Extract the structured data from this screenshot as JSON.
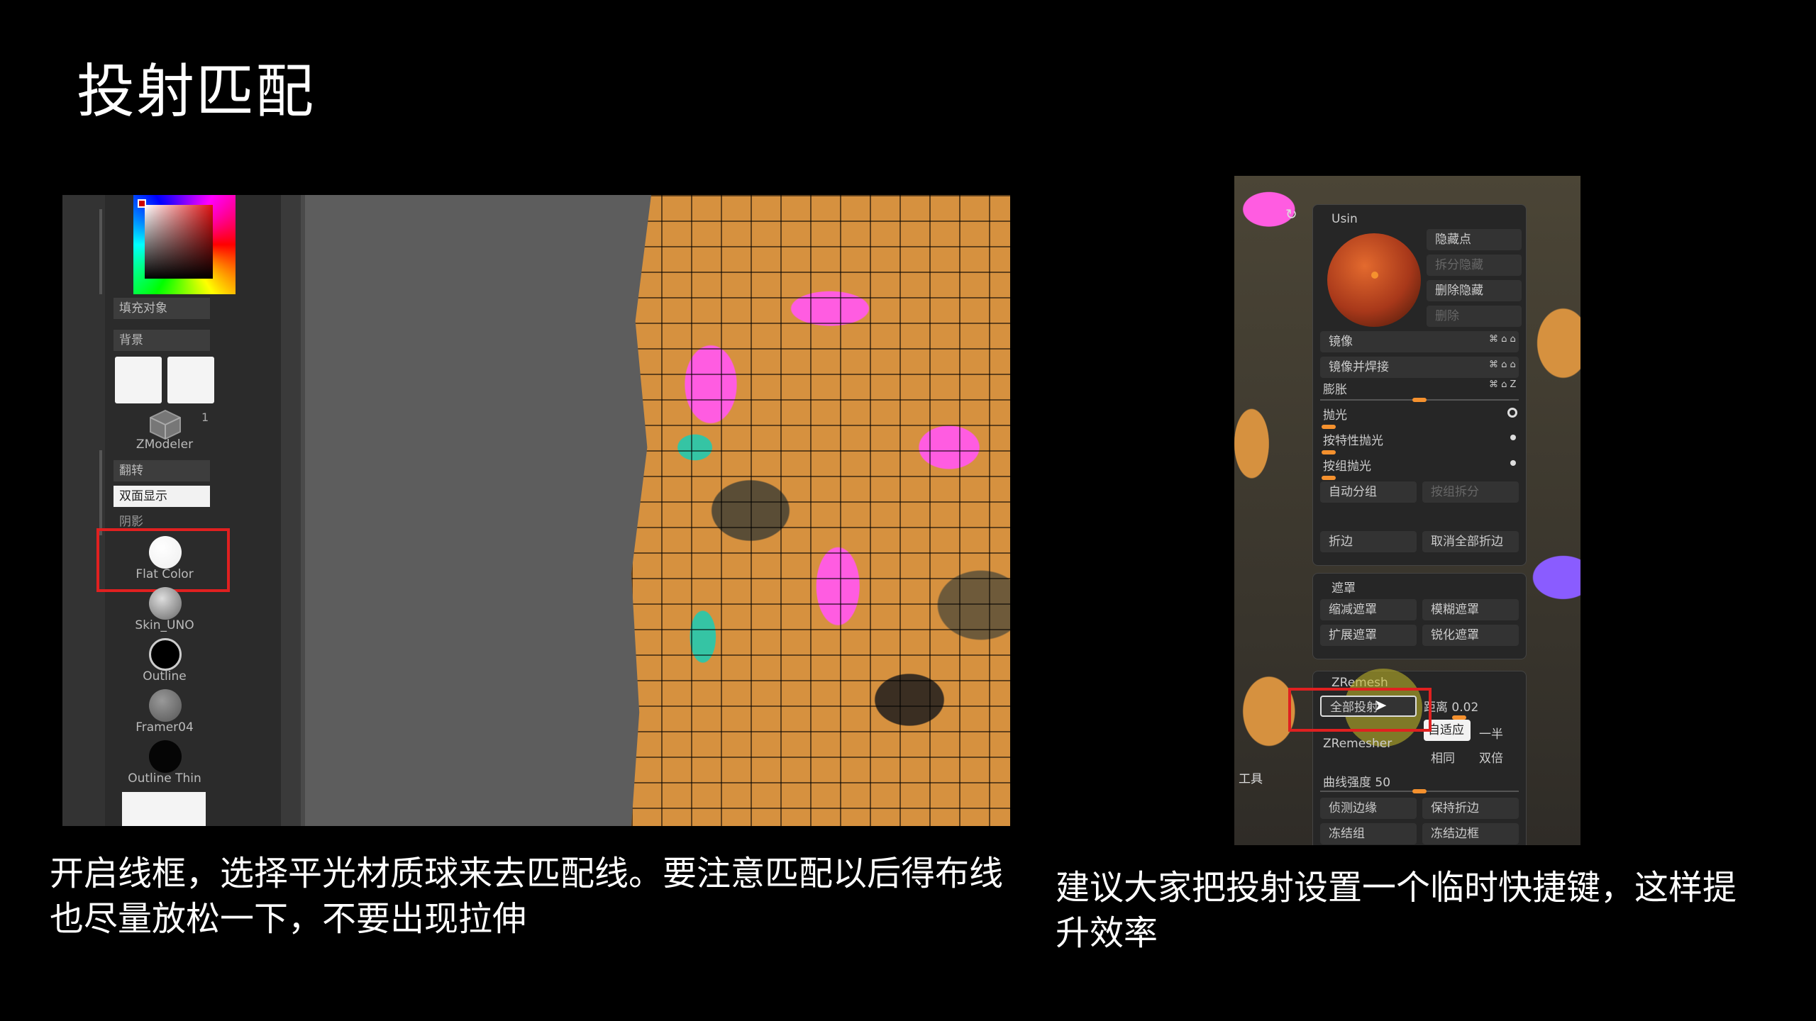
{
  "slide": {
    "title": "投射匹配",
    "caption_left": "开启线框，选择平光材质球来去匹配线。要注意匹配以后得布线也尽量放松一下，不要出现拉伸",
    "caption_right": "建议大家把投射设置一个临时快捷键，这样提升效率"
  },
  "left_shot": {
    "fill_object": "填充对象",
    "background": "背景",
    "tool_count": "1",
    "tool_name": "ZModeler",
    "flip": "翻转",
    "double_sided": "双面显示",
    "shadow": "阴影",
    "materials": [
      {
        "name": "Flat Color",
        "color": "#ffffff",
        "highlighted": true
      },
      {
        "name": "Skin_UNO",
        "color": "#9a9a9a"
      },
      {
        "name": "Outline",
        "color": "#000000"
      },
      {
        "name": "Framer04",
        "color": "#7a7a7a"
      },
      {
        "name": "Outline Thin",
        "color": "#050505"
      }
    ],
    "highlight_color": "#e02020"
  },
  "right_shot": {
    "header": "Usin",
    "side_buttons": [
      "隐藏点",
      "拆分隐藏",
      "删除隐藏",
      "删除"
    ],
    "rows": [
      {
        "label": "镜像",
        "icons": "⌘ ⌂ ⌂"
      },
      {
        "label": "镜像并焊接",
        "icons": "⌘ ⌂ ⌂"
      },
      {
        "label": "膨胀",
        "icons": "⌘ ⌂ Z"
      },
      {
        "label": "抛光"
      },
      {
        "label": "按特性抛光"
      },
      {
        "label": "按组抛光"
      }
    ],
    "auto_group": "自动分组",
    "split_group": "按组拆分",
    "crease": "折边",
    "uncrease_all": "取消全部折边",
    "mask_title": "遮罩",
    "mask_buttons": [
      "缩减遮罩",
      "模糊遮罩",
      "扩展遮罩",
      "锐化遮罩"
    ],
    "zremesh_title": "ZRemesh",
    "project_all": "全部投射",
    "distance": "距离 0.02",
    "adaptive": "自适应",
    "half": "一半",
    "zremesher": "ZRemesher",
    "same": "相同",
    "double": "双倍",
    "curve_strength": "曲线强度 50",
    "detect_edges": "侦测边缘",
    "keep_creases": "保持折边",
    "freeze_groups": "冻结组",
    "freeze_borders": "冻结边框",
    "tool_side": "工具",
    "accent_color": "#f5912e"
  }
}
